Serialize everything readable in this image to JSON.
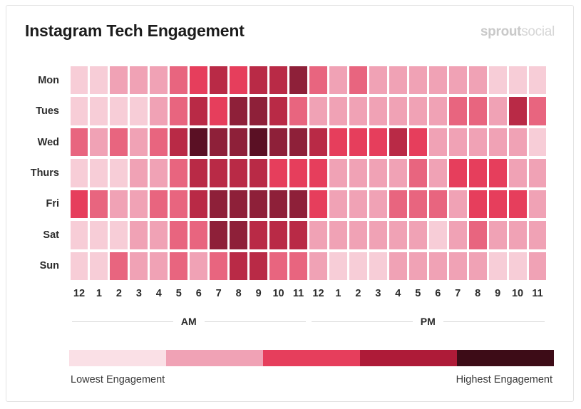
{
  "header": {
    "title": "Instagram Tech Engagement",
    "brand_primary": "sprout",
    "brand_secondary": "social"
  },
  "legend": {
    "low_label": "Lowest Engagement",
    "high_label": "Highest Engagement",
    "colors": [
      "#fae0e6",
      "#f0a2b5",
      "#e63e5c",
      "#ae1b38",
      "#3d0c17"
    ]
  },
  "axis": {
    "periods": [
      "AM",
      "PM"
    ]
  },
  "chart_data": {
    "type": "heatmap",
    "title": "Instagram Tech Engagement",
    "xlabel": "",
    "ylabel": "",
    "grid": false,
    "legend_position": "bottom",
    "colorscale": [
      "#fbeaee",
      "#f7cdd7",
      "#f0a2b5",
      "#e8657f",
      "#e63e5c",
      "#b92a46",
      "#8e2039",
      "#5a1024",
      "#3d0c17"
    ],
    "value_range": [
      0,
      10
    ],
    "x_categories": [
      "12",
      "1",
      "2",
      "3",
      "4",
      "5",
      "6",
      "7",
      "8",
      "9",
      "10",
      "11",
      "12",
      "1",
      "2",
      "3",
      "4",
      "5",
      "6",
      "7",
      "8",
      "9",
      "10",
      "11"
    ],
    "x_periods": [
      "AM",
      "AM",
      "AM",
      "AM",
      "AM",
      "AM",
      "AM",
      "AM",
      "AM",
      "AM",
      "AM",
      "AM",
      "PM",
      "PM",
      "PM",
      "PM",
      "PM",
      "PM",
      "PM",
      "PM",
      "PM",
      "PM",
      "PM",
      "PM"
    ],
    "y_categories": [
      "Mon",
      "Tues",
      "Wed",
      "Thurs",
      "Fri",
      "Sat",
      "Sun"
    ],
    "series": [
      {
        "name": "Mon",
        "values": [
          1,
          1,
          2,
          2,
          3,
          4,
          5,
          6,
          5,
          6,
          6,
          7,
          4,
          3,
          4,
          3,
          3,
          2,
          3,
          3,
          2,
          1,
          1,
          1
        ]
      },
      {
        "name": "Tues",
        "values": [
          1,
          1,
          1,
          1,
          3,
          4,
          6,
          5,
          8,
          7,
          6,
          4,
          3,
          3,
          2,
          3,
          3,
          3,
          3,
          4,
          4,
          3,
          6,
          4
        ]
      },
      {
        "name": "Wed",
        "values": [
          4,
          2,
          4,
          3,
          4,
          6,
          9,
          7,
          7,
          9,
          8,
          7,
          6,
          5,
          5,
          5,
          6,
          5,
          3,
          3,
          2,
          3,
          3,
          1
        ]
      },
      {
        "name": "Thurs",
        "values": [
          1,
          1,
          1,
          2,
          3,
          4,
          6,
          6,
          6,
          6,
          5,
          5,
          5,
          3,
          3,
          3,
          3,
          4,
          3,
          5,
          5,
          5,
          3,
          2
        ]
      },
      {
        "name": "Fri",
        "values": [
          5,
          4,
          3,
          3,
          4,
          4,
          6,
          8,
          8,
          8,
          8,
          8,
          5,
          3,
          3,
          3,
          4,
          4,
          4,
          3,
          5,
          5,
          5,
          2
        ]
      },
      {
        "name": "Sat",
        "values": [
          1,
          1,
          1,
          2,
          3,
          4,
          4,
          7,
          7,
          6,
          6,
          6,
          3,
          3,
          3,
          2,
          2,
          2,
          1,
          2,
          4,
          2,
          3,
          2
        ]
      },
      {
        "name": "Sun",
        "values": [
          1,
          1,
          4,
          2,
          2,
          4,
          2,
          4,
          6,
          6,
          4,
          4,
          2,
          1,
          1,
          1,
          2,
          2,
          2,
          2,
          2,
          1,
          1,
          2
        ]
      }
    ]
  }
}
